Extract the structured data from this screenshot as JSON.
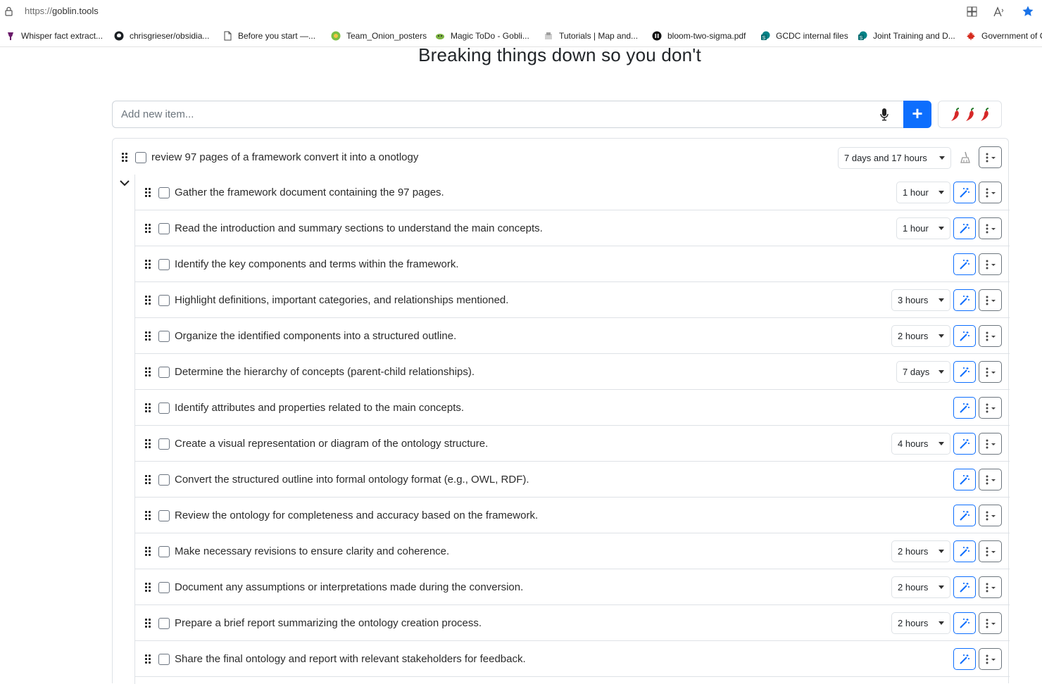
{
  "browser": {
    "url_protocol": "https://",
    "url_host": "goblin.tools",
    "bookmarks": [
      {
        "label": "Whisper fact extract...",
        "icon": "whisper-icon",
        "color": "#8a2b8a"
      },
      {
        "label": "chrisgrieser/obsidia...",
        "icon": "github-icon",
        "color": "#1b1f23"
      },
      {
        "label": "Before you start —...",
        "icon": "page-icon",
        "color": "#ffffff"
      },
      {
        "label": "Team_Onion_posters",
        "icon": "onion-icon",
        "color": "#4caf50"
      },
      {
        "label": "Magic ToDo - Gobli...",
        "icon": "goblin-icon",
        "color": "#7cb342"
      },
      {
        "label": "Tutorials | Map and...",
        "icon": "map-icon",
        "color": "#b0b0b0"
      },
      {
        "label": "bloom-two-sigma.pdf",
        "icon": "pdf-icon",
        "color": "#111111"
      },
      {
        "label": "GCDC internal files",
        "icon": "sharepoint-icon",
        "color": "#038387"
      },
      {
        "label": "Joint Training and D...",
        "icon": "sharepoint-icon",
        "color": "#038387"
      },
      {
        "label": "Government of C",
        "icon": "maple-leaf-icon",
        "color": "#d52b1e"
      }
    ]
  },
  "page": {
    "title": "Breaking things down so you don't",
    "add_placeholder": "Add new item...",
    "plus_label": "+",
    "spiciness_level": 3
  },
  "task": {
    "text": "review 97 pages of a framework convert it into a onotlogy",
    "duration": "7 days and 17 hours",
    "subtasks": [
      {
        "text": "Gather the framework document containing the 97 pages.",
        "duration": "1 hour"
      },
      {
        "text": "Read the introduction and summary sections to understand the main concepts.",
        "duration": "1 hour"
      },
      {
        "text": "Identify the key components and terms within the framework.",
        "duration": ""
      },
      {
        "text": "Highlight definitions, important categories, and relationships mentioned.",
        "duration": "3 hours"
      },
      {
        "text": "Organize the identified components into a structured outline.",
        "duration": "2 hours"
      },
      {
        "text": "Determine the hierarchy of concepts (parent-child relationships).",
        "duration": "7 days"
      },
      {
        "text": "Identify attributes and properties related to the main concepts.",
        "duration": ""
      },
      {
        "text": "Create a visual representation or diagram of the ontology structure.",
        "duration": "4 hours"
      },
      {
        "text": "Convert the structured outline into formal ontology format (e.g., OWL, RDF).",
        "duration": ""
      },
      {
        "text": "Review the ontology for completeness and accuracy based on the framework.",
        "duration": ""
      },
      {
        "text": "Make necessary revisions to ensure clarity and coherence.",
        "duration": "2 hours"
      },
      {
        "text": "Document any assumptions or interpretations made during the conversion.",
        "duration": "2 hours"
      },
      {
        "text": "Prepare a brief report summarizing the ontology creation process.",
        "duration": "2 hours"
      },
      {
        "text": "Share the final ontology and report with relevant stakeholders for feedback.",
        "duration": ""
      }
    ]
  },
  "colors": {
    "primary": "#0d6efd",
    "border": "#dee2e6",
    "chili": "#d62828"
  }
}
